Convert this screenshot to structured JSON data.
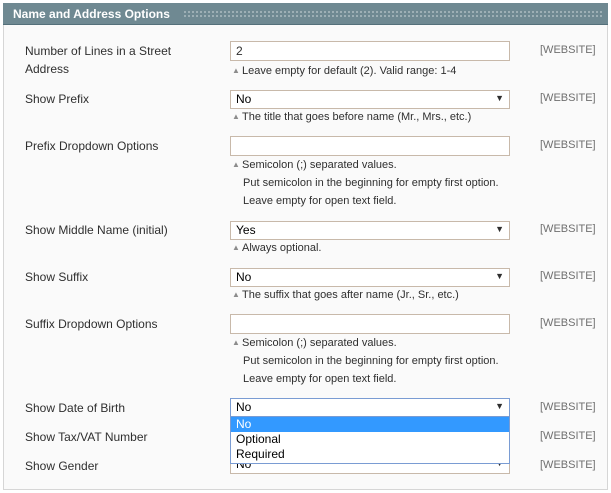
{
  "section_title": "Name and Address Options",
  "scope_label": "[WEBSITE]",
  "street_lines": {
    "label_line1": "Number of Lines in a Street",
    "label_line2": "Address",
    "value": "2",
    "note": "Leave empty for default (2). Valid range: 1-4"
  },
  "show_prefix": {
    "label": "Show Prefix",
    "value": "No",
    "note": "The title that goes before name (Mr., Mrs., etc.)"
  },
  "prefix_options": {
    "label": "Prefix Dropdown Options",
    "value": "",
    "note_line1": "Semicolon (;) separated values.",
    "note_line2": "Put semicolon in the beginning for empty first option.",
    "note_line3": "Leave empty for open text field."
  },
  "show_middle_name": {
    "label": "Show Middle Name (initial)",
    "value": "Yes",
    "note": "Always optional."
  },
  "show_suffix": {
    "label": "Show Suffix",
    "value": "No",
    "note": "The suffix that goes after name (Jr., Sr., etc.)"
  },
  "suffix_options": {
    "label": "Suffix Dropdown Options",
    "value": "",
    "note_line1": "Semicolon (;) separated values.",
    "note_line2": "Put semicolon in the beginning for empty first option.",
    "note_line3": "Leave empty for open text field."
  },
  "show_dob": {
    "label": "Show Date of Birth",
    "value": "No",
    "options": [
      "No",
      "Optional",
      "Required"
    ],
    "highlighted_option": "No"
  },
  "show_taxvat": {
    "label": "Show Tax/VAT Number"
  },
  "show_gender": {
    "label": "Show Gender",
    "value": "No"
  },
  "colors": {
    "header_bg": "#6f8992",
    "input_border": "#c8b9aa",
    "highlight": "#3399ff"
  }
}
